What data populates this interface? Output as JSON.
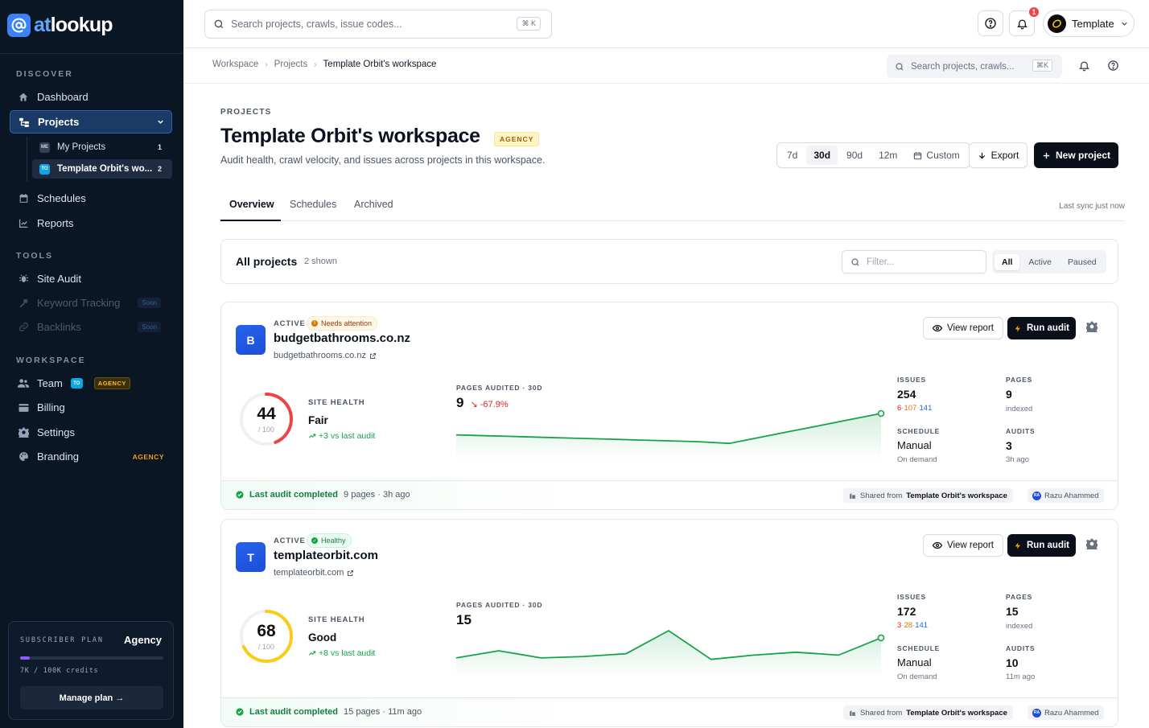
{
  "brand": {
    "name_prefix": "at",
    "name_suffix": "lookup"
  },
  "sidebar": {
    "discover_label": "DISCOVER",
    "tools_label": "TOOLS",
    "workspace_label": "WORKSPACE",
    "items": {
      "dashboard": "Dashboard",
      "projects": "Projects",
      "schedules": "Schedules",
      "reports": "Reports",
      "site_audit": "Site Audit",
      "keyword_tracking": "Keyword Tracking",
      "backlinks": "Backlinks",
      "team": "Team",
      "billing": "Billing",
      "settings": "Settings",
      "branding": "Branding"
    },
    "soon_label": "Soon",
    "team_badge": "TO",
    "agency_tag": "AGENCY",
    "sub_projects": [
      {
        "icon": "ME",
        "label": "My Projects",
        "count": "1"
      },
      {
        "icon": "TO",
        "label": "Template Orbit's wo...",
        "count": "2"
      }
    ],
    "plan": {
      "label": "SUBSCRIBER PLAN",
      "name": "Agency",
      "usage_fraction": 0.07,
      "credits": "7K / 100K credits",
      "button": "Manage plan →"
    }
  },
  "topbar": {
    "search_placeholder": "Search projects, crawls, issue codes...",
    "shortcut": "⌘ K",
    "notification_count": "1",
    "user_name": "Template"
  },
  "breadcrumb": {
    "items": [
      "Workspace",
      "Projects",
      "Template Orbit's workspace"
    ],
    "search_placeholder": "Search projects, crawls...",
    "shortcut": "⌘K"
  },
  "header": {
    "eyebrow": "PROJECTS",
    "title": "Template Orbit's workspace",
    "tag": "AGENCY",
    "subtitle": "Audit health, crawl velocity, and issues across projects in this workspace.",
    "ranges": [
      "7d",
      "30d",
      "90d",
      "12m",
      "Custom"
    ],
    "active_range": "30d",
    "export_label": "Export",
    "new_project_label": "New project"
  },
  "tabs": {
    "items": [
      "Overview",
      "Schedules",
      "Archived"
    ],
    "active": "Overview",
    "sync_text": "Last sync just now"
  },
  "filter_card": {
    "title": "All projects",
    "count_text": "2 shown",
    "filter_placeholder": "Filter...",
    "segments": [
      "All",
      "Active",
      "Paused"
    ],
    "active_segment": "All"
  },
  "common": {
    "status_active": "ACTIVE",
    "view_report": "View report",
    "run_audit": "Run audit",
    "site_health_label": "SITE HEALTH",
    "pages_audited_label": "PAGES AUDITED · 30D",
    "issues_label": "ISSUES",
    "pages_label": "PAGES",
    "schedule_label": "SCHEDULE",
    "audits_label": "AUDITS",
    "score_den": "/ 100",
    "indexed": "indexed",
    "shared_from": "Shared from",
    "owner_initials": "RA"
  },
  "projects": [
    {
      "initial": "B",
      "badge": "Needs attention",
      "badge_kind": "warn",
      "domain": "budgetbathrooms.co.nz",
      "url": "budgetbathrooms.co.nz",
      "score": 44,
      "score_color": "#ef4444",
      "grade": "Fair",
      "delta": "+3 vs last audit",
      "pages_audited": "9",
      "pages_delta": "-67.9%",
      "spark": [
        22,
        21,
        20,
        19,
        18,
        17,
        16,
        15,
        14,
        12,
        19,
        26,
        33,
        40,
        47
      ],
      "issues_total": "254",
      "issues_high": "6",
      "issues_mid": "107",
      "issues_low": "141",
      "pages": "9",
      "schedule": "Manual",
      "schedule_sub": "On demand",
      "audits": "3",
      "audits_sub": "3h ago",
      "footer_status": "Last audit completed",
      "footer_meta": "9 pages · 3h ago",
      "workspace": "Template Orbit's workspace",
      "owner": "Razu Ahammed"
    },
    {
      "initial": "T",
      "badge": "Healthy",
      "badge_kind": "good",
      "domain": "templateorbit.com",
      "url": "templateorbit.com",
      "score": 68,
      "score_color": "#facc15",
      "grade": "Good",
      "delta": "+8 vs last audit",
      "pages_audited": "15",
      "pages_delta": "",
      "spark": [
        9,
        14,
        9,
        10,
        12,
        28,
        8,
        11,
        13,
        11,
        23
      ],
      "issues_total": "172",
      "issues_high": "3",
      "issues_mid": "28",
      "issues_low": "141",
      "pages": "15",
      "schedule": "Manual",
      "schedule_sub": "On demand",
      "audits": "10",
      "audits_sub": "11m ago",
      "footer_status": "Last audit completed",
      "footer_meta": "15 pages · 11m ago",
      "workspace": "Template Orbit's workspace",
      "owner": "Razu Ahammed"
    }
  ]
}
